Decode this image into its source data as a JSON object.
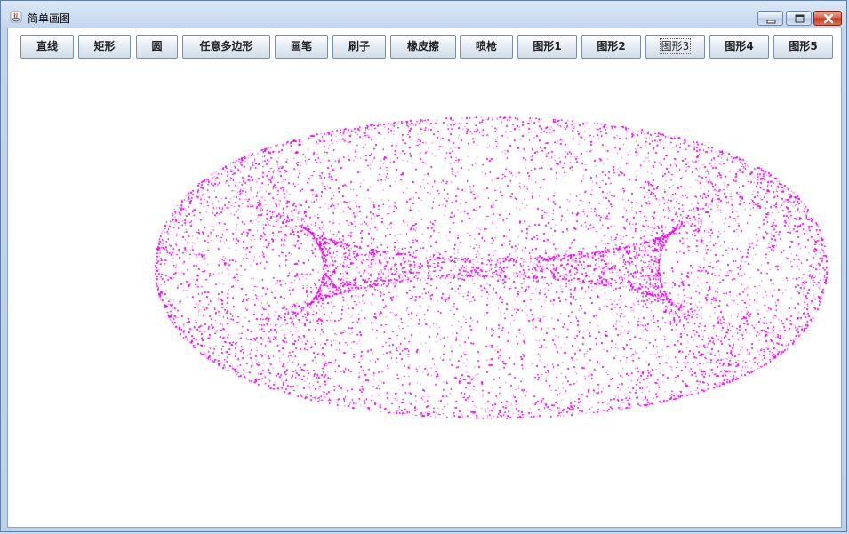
{
  "window": {
    "title": "简单画图",
    "colors": {
      "frame": "#c4d6ee",
      "canvas_background": "#ffffff",
      "drawing_color": "#e800e8"
    }
  },
  "titlebar": {
    "icons": [
      "java-app-icon",
      "minimize-icon",
      "maximize-icon",
      "close-icon"
    ]
  },
  "toolbar": {
    "buttons": [
      {
        "label": "直线"
      },
      {
        "label": "矩形"
      },
      {
        "label": "圆"
      },
      {
        "label": "任意多边形"
      },
      {
        "label": "画笔"
      },
      {
        "label": "刷子"
      },
      {
        "label": "橡皮擦"
      },
      {
        "label": "喷枪"
      },
      {
        "label": "图形1"
      },
      {
        "label": "图形2"
      },
      {
        "label": "图形3",
        "focused": true
      },
      {
        "label": "图形4"
      },
      {
        "label": "图形5"
      }
    ]
  },
  "canvas": {
    "drawing": "torus-point-cloud"
  }
}
